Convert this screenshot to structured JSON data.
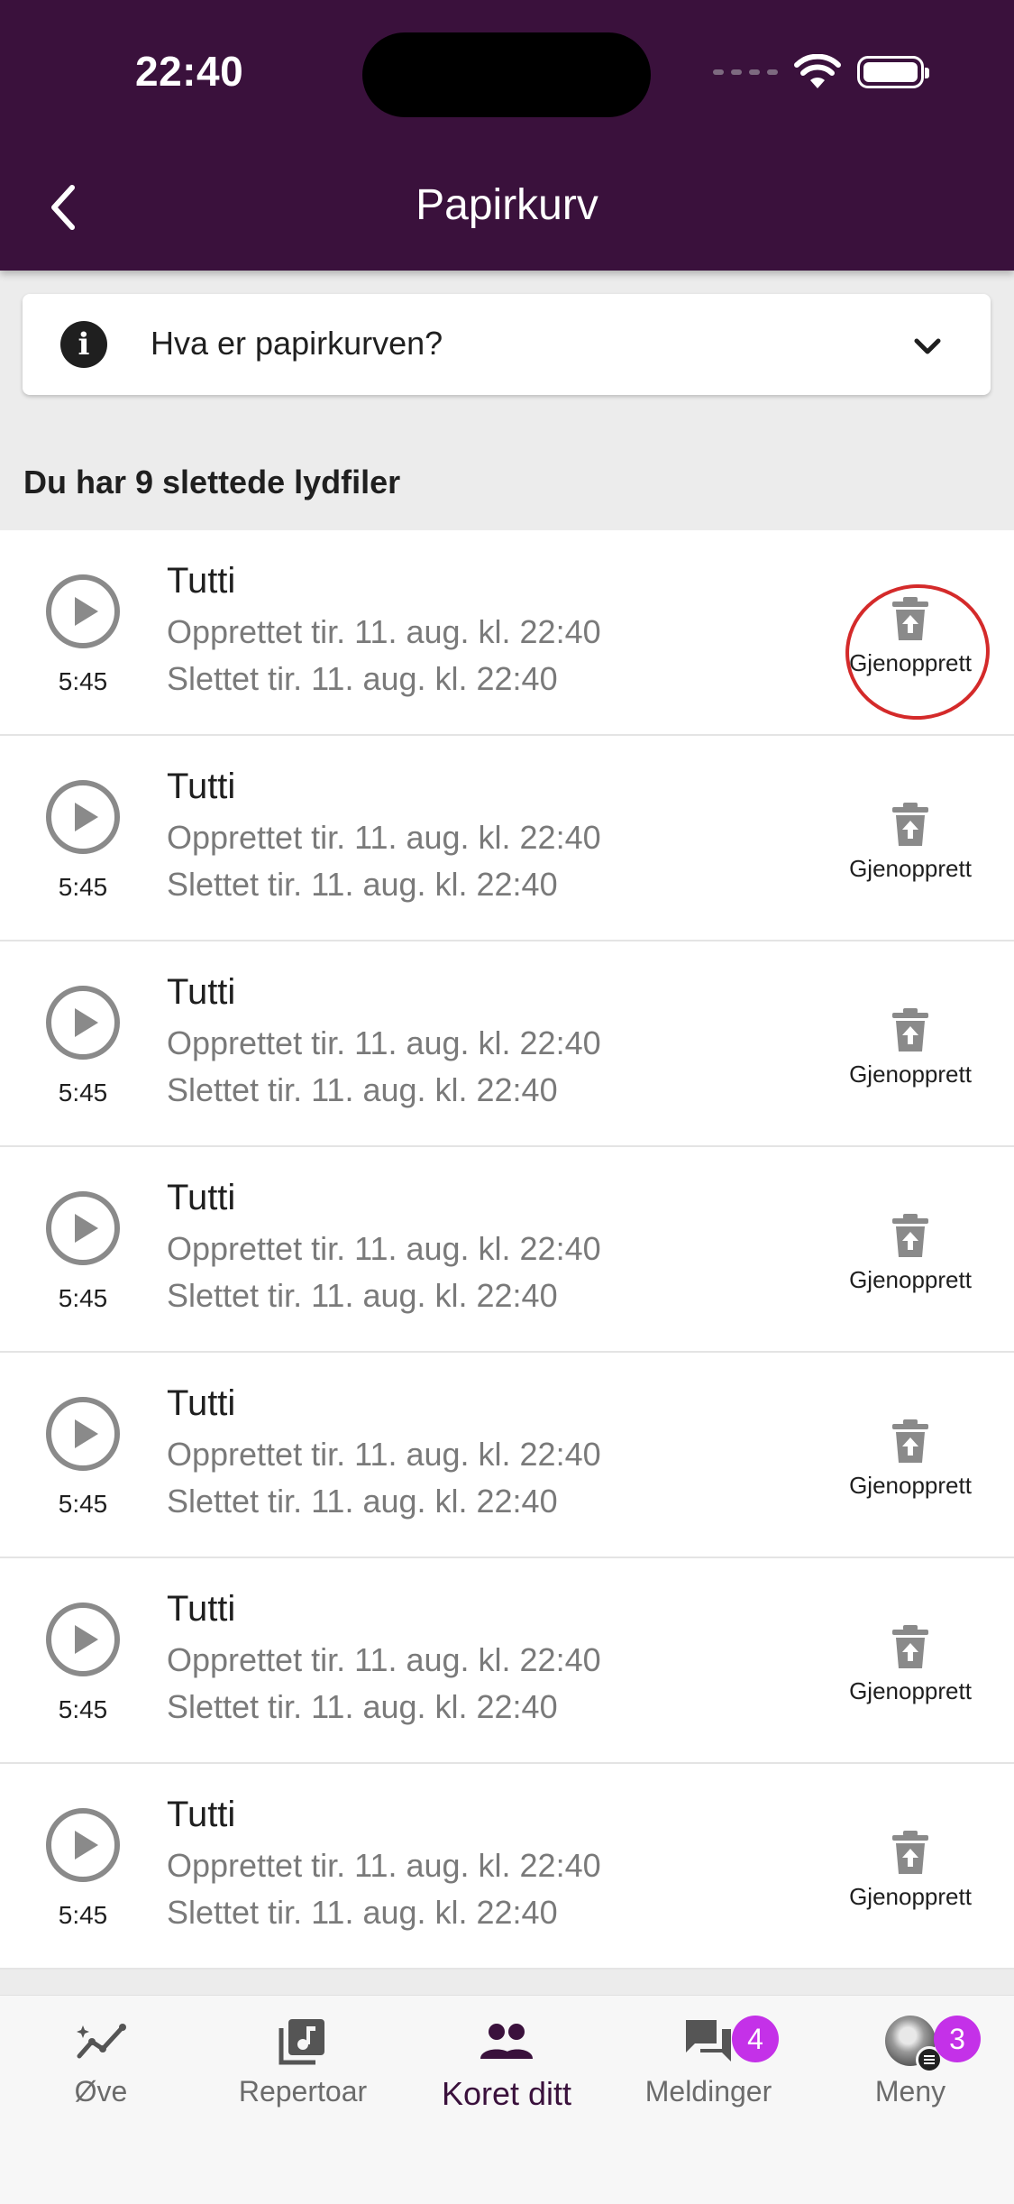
{
  "status_bar": {
    "time": "22:40"
  },
  "header": {
    "title": "Papirkurv"
  },
  "info_card": {
    "question": "Hva er papirkurven?"
  },
  "heading": "Du har 9 slettede lydfiler",
  "items": [
    {
      "title": "Tutti",
      "created": "Opprettet tir. 11. aug. kl. 22:40",
      "deleted": "Slettet tir. 11. aug. kl. 22:40",
      "duration": "5:45",
      "restore_label": "Gjenopprett"
    },
    {
      "title": "Tutti",
      "created": "Opprettet tir. 11. aug. kl. 22:40",
      "deleted": "Slettet tir. 11. aug. kl. 22:40",
      "duration": "5:45",
      "restore_label": "Gjenopprett"
    },
    {
      "title": "Tutti",
      "created": "Opprettet tir. 11. aug. kl. 22:40",
      "deleted": "Slettet tir. 11. aug. kl. 22:40",
      "duration": "5:45",
      "restore_label": "Gjenopprett"
    },
    {
      "title": "Tutti",
      "created": "Opprettet tir. 11. aug. kl. 22:40",
      "deleted": "Slettet tir. 11. aug. kl. 22:40",
      "duration": "5:45",
      "restore_label": "Gjenopprett"
    },
    {
      "title": "Tutti",
      "created": "Opprettet tir. 11. aug. kl. 22:40",
      "deleted": "Slettet tir. 11. aug. kl. 22:40",
      "duration": "5:45",
      "restore_label": "Gjenopprett"
    },
    {
      "title": "Tutti",
      "created": "Opprettet tir. 11. aug. kl. 22:40",
      "deleted": "Slettet tir. 11. aug. kl. 22:40",
      "duration": "5:45",
      "restore_label": "Gjenopprett"
    },
    {
      "title": "Tutti",
      "created": "Opprettet tir. 11. aug. kl. 22:40",
      "deleted": "Slettet tir. 11. aug. kl. 22:40",
      "duration": "5:45",
      "restore_label": "Gjenopprett"
    }
  ],
  "bottom_nav": {
    "items": [
      {
        "label": "Øve",
        "icon": "practice-chart-icon"
      },
      {
        "label": "Repertoar",
        "icon": "music-library-icon"
      },
      {
        "label": "Koret ditt",
        "icon": "group-icon",
        "active": true
      },
      {
        "label": "Meldinger",
        "icon": "chat-icon",
        "badge": "4"
      },
      {
        "label": "Meny",
        "icon": "avatar-menu-icon",
        "badge": "3"
      }
    ]
  },
  "colors": {
    "header_bg": "#3a113c",
    "active_nav": "#3a113c",
    "badge": "#c431e8",
    "highlight_ring": "#d42a2a",
    "secondary_text": "#7a7a7a"
  }
}
